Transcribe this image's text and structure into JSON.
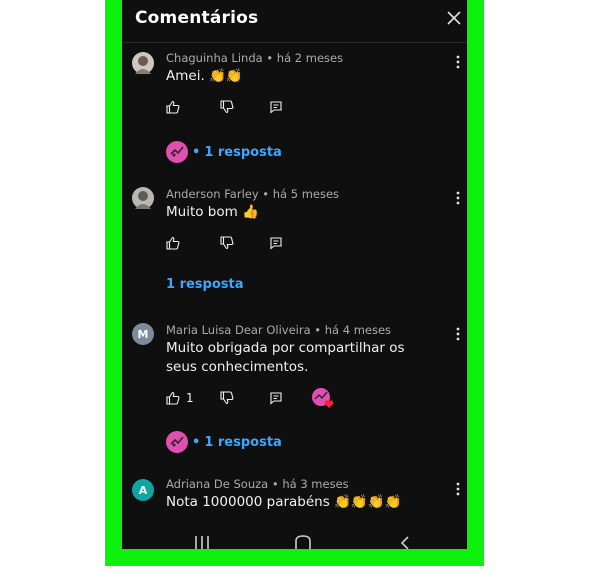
{
  "header": {
    "title": "Comentários"
  },
  "comments": [
    {
      "author": "Chaguinha Linda",
      "time": "há 2 meses",
      "text": "Amei. 👏👏",
      "avatar_color": "#cfc6c2",
      "avatar_letter": "",
      "likes": "",
      "reply_label": "1 resposta",
      "creator_reply": true,
      "hearted": false
    },
    {
      "author": "Anderson Farley",
      "time": "há 5 meses",
      "text": "Muito bom 👍",
      "avatar_color": "#b8b8b0",
      "avatar_letter": "",
      "likes": "",
      "reply_label": "1 resposta",
      "creator_reply": false,
      "hearted": false
    },
    {
      "author": "Maria Luisa Dear Oliveira",
      "time": "há 4 meses",
      "text": "Muito obrigada por compartilhar os seus conhecimentos.",
      "avatar_color": "#7b8a9c",
      "avatar_letter": "M",
      "likes": "1",
      "reply_label": "1 resposta",
      "creator_reply": true,
      "hearted": true
    },
    {
      "author": "Adriana De Souza",
      "time": "há 3 meses",
      "text": "Nota 1000000 parabéns 👏👏👏👏",
      "avatar_color": "#12a3a3",
      "avatar_letter": "A",
      "likes": "",
      "reply_label": "",
      "creator_reply": false,
      "hearted": false
    }
  ],
  "colors": {
    "frame": "#0cf20c",
    "background": "#0f0f0f",
    "link": "#3ea6ff",
    "creator_avatar": "#e14fb0"
  },
  "icons": [
    "close-icon",
    "kebab-icon",
    "thumb-up-icon",
    "thumb-down-icon",
    "reply-icon",
    "heart-icon",
    "nav-recents-icon",
    "nav-home-icon",
    "nav-back-icon"
  ]
}
